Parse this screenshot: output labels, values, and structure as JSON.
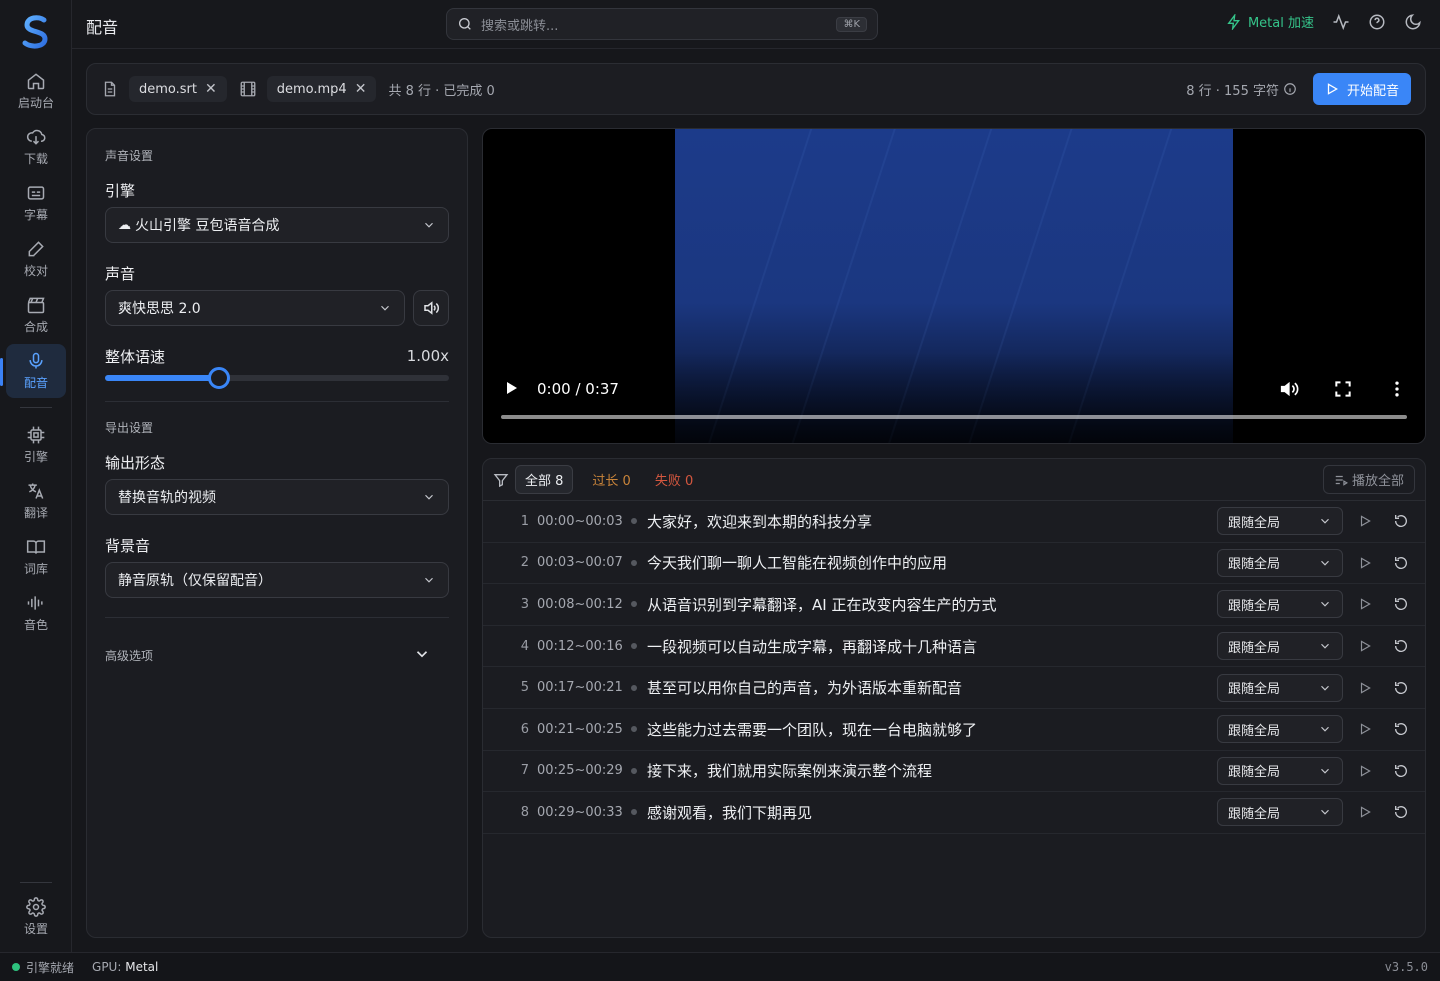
{
  "app": {
    "title": "配音"
  },
  "search": {
    "placeholder": "搜索或跳转...",
    "shortcut": "⌘K"
  },
  "topbar": {
    "metal_label": "Metal 加速"
  },
  "sidebar": {
    "items": [
      {
        "id": "home",
        "label": "启动台",
        "icon": "home-icon"
      },
      {
        "id": "download",
        "label": "下载",
        "icon": "cloud-download-icon"
      },
      {
        "id": "subtitle",
        "label": "字幕",
        "icon": "subtitle-icon"
      },
      {
        "id": "proof",
        "label": "校对",
        "icon": "pen-icon"
      },
      {
        "id": "compose",
        "label": "合成",
        "icon": "clapperboard-icon"
      },
      {
        "id": "dub",
        "label": "配音",
        "icon": "mic-icon",
        "active": true
      },
      {
        "id": "engine",
        "label": "引擎",
        "icon": "cpu-icon"
      },
      {
        "id": "translate",
        "label": "翻译",
        "icon": "translate-icon"
      },
      {
        "id": "glossary",
        "label": "词库",
        "icon": "book-icon"
      },
      {
        "id": "voice",
        "label": "音色",
        "icon": "waveform-icon"
      }
    ],
    "settings_label": "设置"
  },
  "filebar": {
    "srt_name": "demo.srt",
    "video_name": "demo.mp4",
    "summary": "共 8 行 · 已完成 0",
    "stats": "8 行 · 155 字符",
    "start_label": "开始配音"
  },
  "settings": {
    "voice_section": "声音设置",
    "engine_label": "引擎",
    "engine_value": "火山引擎 豆包语音合成",
    "voice_label": "声音",
    "voice_value": "爽快思思 2.0",
    "speed_label": "整体语速",
    "speed_value": "1.00x",
    "speed_fraction": 0.33,
    "export_section": "导出设置",
    "output_label": "输出形态",
    "output_value": "替换音轨的视频",
    "bgm_label": "背景音",
    "bgm_value": "静音原轨（仅保留配音）",
    "advanced_label": "高级选项"
  },
  "video": {
    "time": "0:00 / 0:37",
    "progress": 0.0
  },
  "lines_panel": {
    "tabs": {
      "all": "全部 8",
      "too_long": "过长 0",
      "failed": "失败 0"
    },
    "play_all": "播放全部",
    "rows": [
      {
        "idx": "1",
        "time": "00:00~00:03",
        "text": "大家好，欢迎来到本期的科技分享",
        "mode": "跟随全局"
      },
      {
        "idx": "2",
        "time": "00:03~00:07",
        "text": "今天我们聊一聊人工智能在视频创作中的应用",
        "mode": "跟随全局"
      },
      {
        "idx": "3",
        "time": "00:08~00:12",
        "text": "从语音识别到字幕翻译，AI 正在改变内容生产的方式",
        "mode": "跟随全局"
      },
      {
        "idx": "4",
        "time": "00:12~00:16",
        "text": "一段视频可以自动生成字幕，再翻译成十几种语言",
        "mode": "跟随全局"
      },
      {
        "idx": "5",
        "time": "00:17~00:21",
        "text": "甚至可以用你自己的声音，为外语版本重新配音",
        "mode": "跟随全局"
      },
      {
        "idx": "6",
        "time": "00:21~00:25",
        "text": "这些能力过去需要一个团队，现在一台电脑就够了",
        "mode": "跟随全局"
      },
      {
        "idx": "7",
        "time": "00:25~00:29",
        "text": "接下来，我们就用实际案例来演示整个流程",
        "mode": "跟随全局"
      },
      {
        "idx": "8",
        "time": "00:29~00:33",
        "text": "感谢观看，我们下期再见",
        "mode": "跟随全局"
      }
    ]
  },
  "statusbar": {
    "engine": "引擎就绪",
    "gpu_label": "GPU:",
    "gpu_value": "Metal",
    "version": "v3.5.0"
  }
}
